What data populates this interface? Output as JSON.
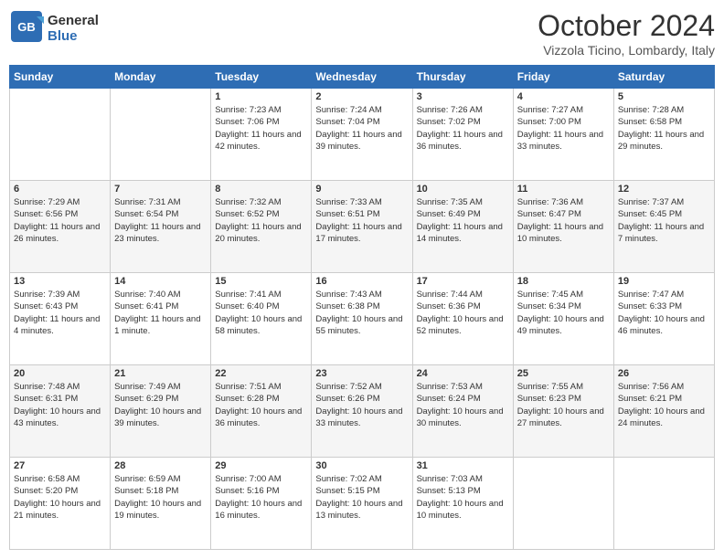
{
  "header": {
    "logo_general": "General",
    "logo_blue": "Blue",
    "month_title": "October 2024",
    "location": "Vizzola Ticino, Lombardy, Italy"
  },
  "days_of_week": [
    "Sunday",
    "Monday",
    "Tuesday",
    "Wednesday",
    "Thursday",
    "Friday",
    "Saturday"
  ],
  "weeks": [
    [
      {
        "day": "",
        "info": ""
      },
      {
        "day": "",
        "info": ""
      },
      {
        "day": "1",
        "info": "Sunrise: 7:23 AM\nSunset: 7:06 PM\nDaylight: 11 hours and 42 minutes."
      },
      {
        "day": "2",
        "info": "Sunrise: 7:24 AM\nSunset: 7:04 PM\nDaylight: 11 hours and 39 minutes."
      },
      {
        "day": "3",
        "info": "Sunrise: 7:26 AM\nSunset: 7:02 PM\nDaylight: 11 hours and 36 minutes."
      },
      {
        "day": "4",
        "info": "Sunrise: 7:27 AM\nSunset: 7:00 PM\nDaylight: 11 hours and 33 minutes."
      },
      {
        "day": "5",
        "info": "Sunrise: 7:28 AM\nSunset: 6:58 PM\nDaylight: 11 hours and 29 minutes."
      }
    ],
    [
      {
        "day": "6",
        "info": "Sunrise: 7:29 AM\nSunset: 6:56 PM\nDaylight: 11 hours and 26 minutes."
      },
      {
        "day": "7",
        "info": "Sunrise: 7:31 AM\nSunset: 6:54 PM\nDaylight: 11 hours and 23 minutes."
      },
      {
        "day": "8",
        "info": "Sunrise: 7:32 AM\nSunset: 6:52 PM\nDaylight: 11 hours and 20 minutes."
      },
      {
        "day": "9",
        "info": "Sunrise: 7:33 AM\nSunset: 6:51 PM\nDaylight: 11 hours and 17 minutes."
      },
      {
        "day": "10",
        "info": "Sunrise: 7:35 AM\nSunset: 6:49 PM\nDaylight: 11 hours and 14 minutes."
      },
      {
        "day": "11",
        "info": "Sunrise: 7:36 AM\nSunset: 6:47 PM\nDaylight: 11 hours and 10 minutes."
      },
      {
        "day": "12",
        "info": "Sunrise: 7:37 AM\nSunset: 6:45 PM\nDaylight: 11 hours and 7 minutes."
      }
    ],
    [
      {
        "day": "13",
        "info": "Sunrise: 7:39 AM\nSunset: 6:43 PM\nDaylight: 11 hours and 4 minutes."
      },
      {
        "day": "14",
        "info": "Sunrise: 7:40 AM\nSunset: 6:41 PM\nDaylight: 11 hours and 1 minute."
      },
      {
        "day": "15",
        "info": "Sunrise: 7:41 AM\nSunset: 6:40 PM\nDaylight: 10 hours and 58 minutes."
      },
      {
        "day": "16",
        "info": "Sunrise: 7:43 AM\nSunset: 6:38 PM\nDaylight: 10 hours and 55 minutes."
      },
      {
        "day": "17",
        "info": "Sunrise: 7:44 AM\nSunset: 6:36 PM\nDaylight: 10 hours and 52 minutes."
      },
      {
        "day": "18",
        "info": "Sunrise: 7:45 AM\nSunset: 6:34 PM\nDaylight: 10 hours and 49 minutes."
      },
      {
        "day": "19",
        "info": "Sunrise: 7:47 AM\nSunset: 6:33 PM\nDaylight: 10 hours and 46 minutes."
      }
    ],
    [
      {
        "day": "20",
        "info": "Sunrise: 7:48 AM\nSunset: 6:31 PM\nDaylight: 10 hours and 43 minutes."
      },
      {
        "day": "21",
        "info": "Sunrise: 7:49 AM\nSunset: 6:29 PM\nDaylight: 10 hours and 39 minutes."
      },
      {
        "day": "22",
        "info": "Sunrise: 7:51 AM\nSunset: 6:28 PM\nDaylight: 10 hours and 36 minutes."
      },
      {
        "day": "23",
        "info": "Sunrise: 7:52 AM\nSunset: 6:26 PM\nDaylight: 10 hours and 33 minutes."
      },
      {
        "day": "24",
        "info": "Sunrise: 7:53 AM\nSunset: 6:24 PM\nDaylight: 10 hours and 30 minutes."
      },
      {
        "day": "25",
        "info": "Sunrise: 7:55 AM\nSunset: 6:23 PM\nDaylight: 10 hours and 27 minutes."
      },
      {
        "day": "26",
        "info": "Sunrise: 7:56 AM\nSunset: 6:21 PM\nDaylight: 10 hours and 24 minutes."
      }
    ],
    [
      {
        "day": "27",
        "info": "Sunrise: 6:58 AM\nSunset: 5:20 PM\nDaylight: 10 hours and 21 minutes."
      },
      {
        "day": "28",
        "info": "Sunrise: 6:59 AM\nSunset: 5:18 PM\nDaylight: 10 hours and 19 minutes."
      },
      {
        "day": "29",
        "info": "Sunrise: 7:00 AM\nSunset: 5:16 PM\nDaylight: 10 hours and 16 minutes."
      },
      {
        "day": "30",
        "info": "Sunrise: 7:02 AM\nSunset: 5:15 PM\nDaylight: 10 hours and 13 minutes."
      },
      {
        "day": "31",
        "info": "Sunrise: 7:03 AM\nSunset: 5:13 PM\nDaylight: 10 hours and 10 minutes."
      },
      {
        "day": "",
        "info": ""
      },
      {
        "day": "",
        "info": ""
      }
    ]
  ]
}
